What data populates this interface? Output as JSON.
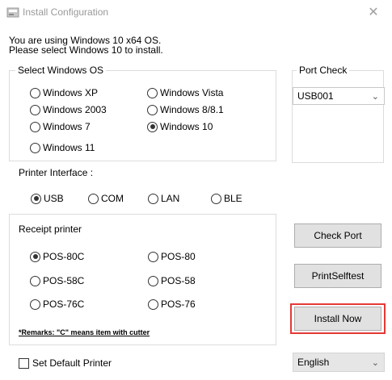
{
  "window": {
    "title": "Install Configuration",
    "close_glyph": "✕"
  },
  "info": {
    "line1": "You are using Windows 10 x64 OS.",
    "line2": "Please select Windows 10 to install."
  },
  "windows_os": {
    "label": "Select Windows OS",
    "options": [
      {
        "label": "Windows XP",
        "checked": false
      },
      {
        "label": "Windows Vista",
        "checked": false
      },
      {
        "label": "Windows 2003",
        "checked": false
      },
      {
        "label": "Windows 8/8.1",
        "checked": false
      },
      {
        "label": "Windows 7",
        "checked": false
      },
      {
        "label": "Windows 10",
        "checked": true
      },
      {
        "label": "Windows 11",
        "checked": false
      }
    ]
  },
  "port_check": {
    "label": "Port Check",
    "selected": "USB001"
  },
  "printer_interface": {
    "label": "Printer Interface :",
    "options": [
      {
        "label": "USB",
        "checked": true
      },
      {
        "label": "COM",
        "checked": false
      },
      {
        "label": "LAN",
        "checked": false
      },
      {
        "label": "BLE",
        "checked": false
      }
    ]
  },
  "receipt_printer": {
    "label": "Receipt printer",
    "options": [
      {
        "label": "POS-80C",
        "checked": true
      },
      {
        "label": "POS-80",
        "checked": false
      },
      {
        "label": "POS-58C",
        "checked": false
      },
      {
        "label": "POS-58",
        "checked": false
      },
      {
        "label": "POS-76C",
        "checked": false
      },
      {
        "label": "POS-76",
        "checked": false
      }
    ],
    "remark": "*Remarks: \"C\" means item with cutter"
  },
  "buttons": {
    "check_port": "Check Port",
    "print_selftest": "PrintSelftest",
    "install_now": "Install Now"
  },
  "set_default_printer": {
    "label": "Set Default Printer",
    "checked": false
  },
  "language": {
    "selected": "English"
  },
  "colors": {
    "highlight": "#e53935"
  }
}
